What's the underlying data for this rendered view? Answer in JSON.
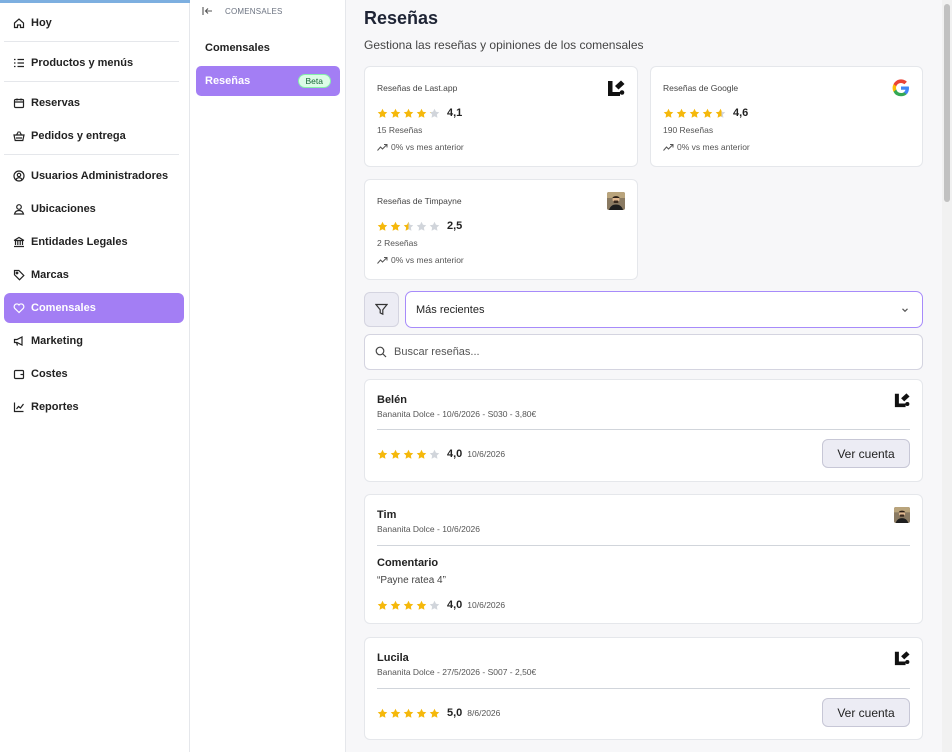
{
  "nav": {
    "items": [
      {
        "label": "Hoy",
        "icon": "home-icon"
      },
      {
        "label": "Productos y menús",
        "icon": "list-icon"
      },
      {
        "label": "Reservas",
        "icon": "calendar-icon"
      },
      {
        "label": "Pedidos y entrega",
        "icon": "basket-icon"
      },
      {
        "label": "Usuarios Administradores",
        "icon": "user-circle-icon"
      },
      {
        "label": "Ubicaciones",
        "icon": "location-icon"
      },
      {
        "label": "Entidades Legales",
        "icon": "bank-icon"
      },
      {
        "label": "Marcas",
        "icon": "tag-icon"
      },
      {
        "label": "Comensales",
        "icon": "heart-icon"
      },
      {
        "label": "Marketing",
        "icon": "megaphone-icon"
      },
      {
        "label": "Costes",
        "icon": "wallet-icon"
      },
      {
        "label": "Reportes",
        "icon": "chart-icon"
      }
    ],
    "active": "Comensales"
  },
  "subnav": {
    "breadcrumb": "COMENSALES",
    "items": [
      {
        "label": "Comensales"
      },
      {
        "label": "Reseñas",
        "badge": "Beta"
      }
    ]
  },
  "page": {
    "title": "Reseñas",
    "subtitle": "Gestiona las reseñas y opiniones de los comensales"
  },
  "stats": [
    {
      "label": "Reseñas de Last.app",
      "rating": 4.1,
      "score": "4,1",
      "count": "15 Reseñas",
      "trend": "0% vs mes anterior",
      "source_icon": "lastapp-logo-icon"
    },
    {
      "label": "Reseñas de Google",
      "rating": 4.6,
      "score": "4,6",
      "count": "190 Reseñas",
      "trend": "0% vs mes anterior",
      "source_icon": "google-logo-icon"
    },
    {
      "label": "Reseñas de Timpayne",
      "rating": 2.5,
      "score": "2,5",
      "count": "2 Reseñas",
      "trend": "0% vs mes anterior",
      "source_icon": "timpayne-avatar-icon"
    }
  ],
  "filters": {
    "sort_selected": "Más recientes",
    "search_placeholder": "Buscar reseñas..."
  },
  "reviews": [
    {
      "name": "Belén",
      "meta": "Bananita Dolce - 10/6/2026 - S030 - 3,80€",
      "rating": 4,
      "score": "4,0",
      "date": "10/6/2026",
      "button": "Ver cuenta",
      "source_icon": "lastapp-logo-icon"
    },
    {
      "name": "Tim",
      "meta": "Bananita Dolce - 10/6/2026",
      "comment_title": "Comentario",
      "comment": "“Payne ratea 4”",
      "rating": 4,
      "score": "4,0",
      "date": "10/6/2026",
      "source_icon": "timpayne-avatar-icon"
    },
    {
      "name": "Lucila",
      "meta": "Bananita Dolce - 27/5/2026 - S007 - 2,50€",
      "rating": 5,
      "score": "5,0",
      "date": "8/6/2026",
      "button": "Ver cuenta",
      "source_icon": "lastapp-logo-icon"
    }
  ],
  "colors": {
    "accent": "#a37ef4",
    "star": "#f5b80b",
    "star_empty": "#d1d5db"
  }
}
